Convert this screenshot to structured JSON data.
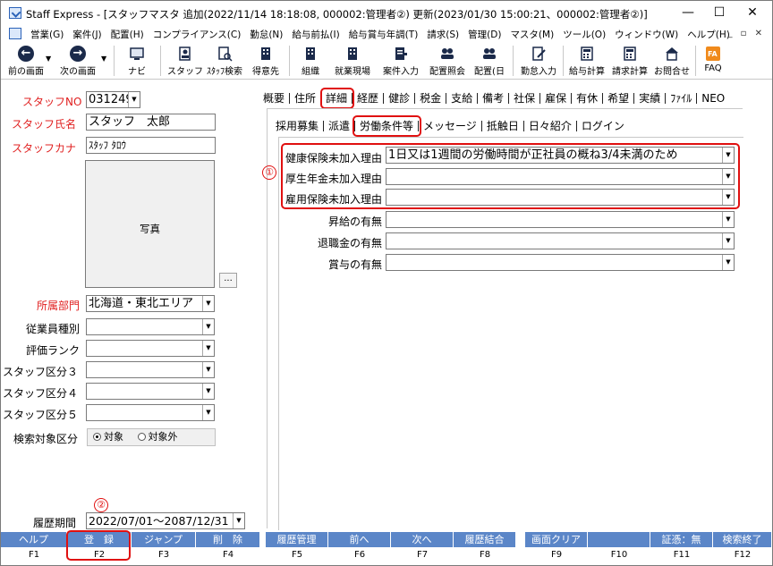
{
  "window": {
    "title": "Staff Express - [スタッフマスタ 追加(2022/11/14 18:18:08, 000002:管理者②) 更新(2023/01/30 15:00:21、000002:管理者②)]",
    "minimize": "—",
    "maximize": "☐",
    "close": "✕"
  },
  "menu": {
    "items": [
      "営業(G)",
      "案件(J)",
      "配置(H)",
      "コンプライアンス(C)",
      "勤怠(N)",
      "給与前払(I)",
      "給与賞与年調(T)",
      "請求(S)",
      "管理(D)",
      "マスタ(M)",
      "ツール(O)",
      "ウィンドウ(W)",
      "ヘルプ(H)"
    ],
    "mdi_controls": "_ ▫ ✕"
  },
  "toolbar": {
    "prev": "前の画面",
    "next": "次の画面",
    "navi": "ナビ",
    "staff": "スタッフ",
    "staff_search": "ｽﾀｯﾌ検索",
    "client": "得意先",
    "org": "組織",
    "site": "就業現場",
    "job_entry": "案件入力",
    "assign_lookup": "配置照会",
    "assign_day": "配置(日",
    "attendance": "勤怠入力",
    "payroll": "給与計算",
    "billing": "請求計算",
    "inquiry": "お問合せ",
    "faq": "FAQ"
  },
  "left": {
    "staff_no_label": "スタッフNO",
    "staff_no_value": "031249",
    "staff_name_label": "スタッフ氏名",
    "staff_name_value": "スタッフ　太郎",
    "staff_kana_label": "スタッフカナ",
    "staff_kana_value": "ｽﾀｯﾌ ﾀﾛｳ",
    "photo_label": "写真",
    "photo_button": "...",
    "dept_label": "所属部門",
    "dept_value": "北海道・東北エリア",
    "emp_type_label": "従業員種別",
    "rank_label": "評価ランク",
    "cat3_label": "スタッフ区分３",
    "cat4_label": "スタッフ区分４",
    "cat5_label": "スタッフ区分５",
    "search_label": "検索対象区分",
    "search_on": "対象",
    "search_off": "対象外",
    "history_label": "履歴期間",
    "history_value": "2022/07/01～2087/12/31"
  },
  "tabs_main": [
    "概要",
    "住所",
    "詳細",
    "経歴",
    "健診",
    "税金",
    "支給",
    "備考",
    "社保",
    "雇保",
    "有休",
    "希望",
    "実績",
    "ﾌｧｲﾙ",
    "NEO"
  ],
  "tabs_sub": [
    "採用募集",
    "派遣",
    "労働条件等",
    "メッセージ",
    "抵触日",
    "日々紹介",
    "ログイン"
  ],
  "detail": {
    "health_label": "健康保険未加入理由",
    "health_value": "1日又は1週間の労働時間が正社員の概ね3/4未満のため",
    "pension_label": "厚生年金未加入理由",
    "pension_value": "",
    "employment_label": "雇用保険未加入理由",
    "employment_value": "",
    "raise_label": "昇給の有無",
    "raise_value": "",
    "retire_label": "退職金の有無",
    "retire_value": "",
    "bonus_label": "賞与の有無",
    "bonus_value": ""
  },
  "annotations": {
    "one": "①",
    "two": "②"
  },
  "fkeys": [
    {
      "label": "ヘルプ",
      "key": "F1"
    },
    {
      "label": "登　録",
      "key": "F2"
    },
    {
      "label": "ジャンプ",
      "key": "F3"
    },
    {
      "label": "削　除",
      "key": "F4"
    },
    {
      "label": "履歴管理",
      "key": "F5"
    },
    {
      "label": "前へ",
      "key": "F6"
    },
    {
      "label": "次へ",
      "key": "F7"
    },
    {
      "label": "履歴結合",
      "key": "F8"
    },
    {
      "label": "画面クリア",
      "key": "F9"
    },
    {
      "label": "",
      "key": "F10"
    },
    {
      "label": "証憑：無",
      "key": "F11"
    },
    {
      "label": "検索終了",
      "key": "F12"
    }
  ],
  "colors": {
    "accent": "#5b86c8",
    "required_label": "#e02020",
    "highlight": "#e01010"
  }
}
